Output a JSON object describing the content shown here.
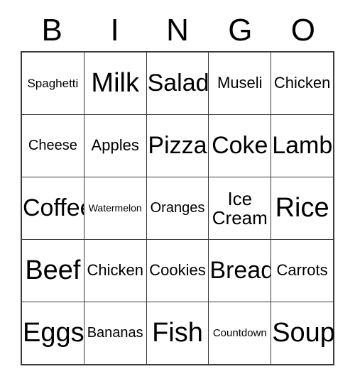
{
  "card": {
    "header_letters": [
      "B",
      "I",
      "N",
      "G",
      "O"
    ],
    "colors": {
      "background": "#ffffff",
      "text": "#000000",
      "grid_line": "#3a3a3a"
    },
    "rows": [
      [
        {
          "label": "Spaghetti",
          "size": "fs-sm"
        },
        {
          "label": "Milk",
          "size": "fs-huge"
        },
        {
          "label": "Salad",
          "size": "fs-xxl"
        },
        {
          "label": "Museli",
          "size": "fs-ml"
        },
        {
          "label": "Chicken",
          "size": "fs-ml"
        }
      ],
      [
        {
          "label": "Cheese",
          "size": "fs-m"
        },
        {
          "label": "Apples",
          "size": "fs-ml"
        },
        {
          "label": "Pizza",
          "size": "fs-xxl"
        },
        {
          "label": "Coke",
          "size": "fs-xxl"
        },
        {
          "label": "Lamb",
          "size": "fs-xxl"
        }
      ],
      [
        {
          "label": "Coffee",
          "size": "fs-xxl"
        },
        {
          "label": "Watermelon",
          "size": "fs-xs"
        },
        {
          "label": "Oranges",
          "size": "fs-m"
        },
        {
          "label": "Ice\nCream",
          "size": "fs-l"
        },
        {
          "label": "Rice",
          "size": "fs-huge"
        }
      ],
      [
        {
          "label": "Beef",
          "size": "fs-huge"
        },
        {
          "label": "Chicken",
          "size": "fs-ml"
        },
        {
          "label": "Cookies",
          "size": "fs-ml"
        },
        {
          "label": "Bread",
          "size": "fs-xxl"
        },
        {
          "label": "Carrots",
          "size": "fs-ml"
        }
      ],
      [
        {
          "label": "Eggs",
          "size": "fs-huge"
        },
        {
          "label": "Bananas",
          "size": "fs-m"
        },
        {
          "label": "Fish",
          "size": "fs-huge"
        },
        {
          "label": "Countdown",
          "size": "fs-s"
        },
        {
          "label": "Soup",
          "size": "fs-huge"
        }
      ]
    ]
  }
}
